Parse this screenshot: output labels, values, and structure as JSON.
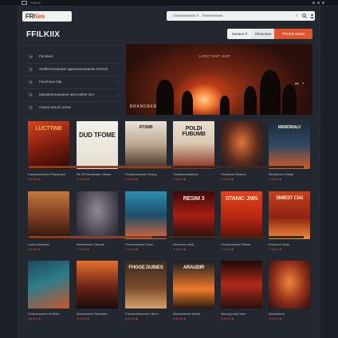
{
  "window": {
    "title": "FRKKE"
  },
  "brand": {
    "prefix": "FR",
    "suffix": "Kes"
  },
  "search": {
    "placeholder": "Gnaeaseaean 5",
    "hint": "Reeeeeeaes"
  },
  "header": {
    "title": "FFILKIIX",
    "tabs": [
      {
        "label": "Saeaea ft",
        "active": false
      },
      {
        "label": "Sheeeaea",
        "active": false
      },
      {
        "label": "FRHKE Nreea",
        "active": true
      }
    ]
  },
  "menu": {
    "items": [
      {
        "label": "Fanekes"
      },
      {
        "label": "Aeeflereeeaeaee ageeeaeeaeaeae heeecit"
      },
      {
        "label": "Feeeheee Dla"
      },
      {
        "label": "Maasteeneaeaeee aea ineltee ieet"
      },
      {
        "label": "Coesa sesull csmse"
      }
    ]
  },
  "hero": {
    "caption": "LFECTHIF IHIF",
    "credit": "BRANDBER"
  },
  "colors": {
    "accent": "#e2542a",
    "background": "#1b1f26",
    "panel": "#222730"
  },
  "rows": [
    {
      "progress": 0.52,
      "items": [
        {
          "poster_text": "LUCTTINE",
          "title": "Faeanieeeeeee Raeaeaee",
          "meta": "★★★★ ■"
        },
        {
          "poster_text": "DUD TFOME",
          "title": "RK SFIrsesfeaee Clfaea",
          "meta": "★★★★ ■"
        },
        {
          "poster_text": "RTSMB",
          "title": "Feaeeeaeaeae Seang",
          "meta": "★★★★ ■"
        },
        {
          "poster_text": "POLDI FUBUMB",
          "title": "Tlodlaeeaeiaeaee",
          "meta": "★★★★ ■"
        },
        {
          "poster_text": "",
          "title": "Feeheaee Beelea",
          "meta": "★★★★ ■"
        },
        {
          "poster_text": "MEMORIALV",
          "title": "Meeaeeee Elfaae",
          "meta": "★★★★ ■"
        }
      ]
    },
    {
      "progress": 0.45,
      "items": [
        {
          "poster_text": "",
          "title": "Laeie Aeeeeee",
          "meta": "★★★★ ■"
        },
        {
          "poster_text": "",
          "title": "Reeteeieee Fadeae",
          "meta": "★★★★ ■"
        },
        {
          "poster_text": "",
          "title": "Feeheeeeeee Dsee",
          "meta": "★★★★ ■"
        },
        {
          "poster_text": "RESIM 3",
          "title": "Reeeeee eeee",
          "meta": "★★★★ ■"
        },
        {
          "poster_text": "STANIC JNIS",
          "title": "Feeheeeeeee Rlleee",
          "meta": "★★★★ ■"
        },
        {
          "poster_text": "SMIEST CIAI",
          "title": "Feeeeee Ssae",
          "meta": "★★★★ ■"
        }
      ]
    },
    {
      "progress": 0.0,
      "items": [
        {
          "poster_text": "",
          "title": "Feeeeeeeeee le Milde",
          "meta": "★★★★ ■"
        },
        {
          "poster_text": "",
          "title": "Meeeeeeee Beeaeea",
          "meta": "★★★★ ■"
        },
        {
          "poster_text": "FHOGE DUBIES",
          "title": "Feeeeeeeeeeeee Beea",
          "meta": "★★★★ ■"
        },
        {
          "poster_text": "ARAUDIR",
          "title": "Reeeeeeeee Beele",
          "meta": "★★★★ ■"
        },
        {
          "poster_text": "",
          "title": "Heeeiig eeie Ieee",
          "meta": "★★★★ ■"
        },
        {
          "poster_text": "",
          "title": "Meaeeleea",
          "meta": "★★★★ ■"
        }
      ]
    }
  ]
}
